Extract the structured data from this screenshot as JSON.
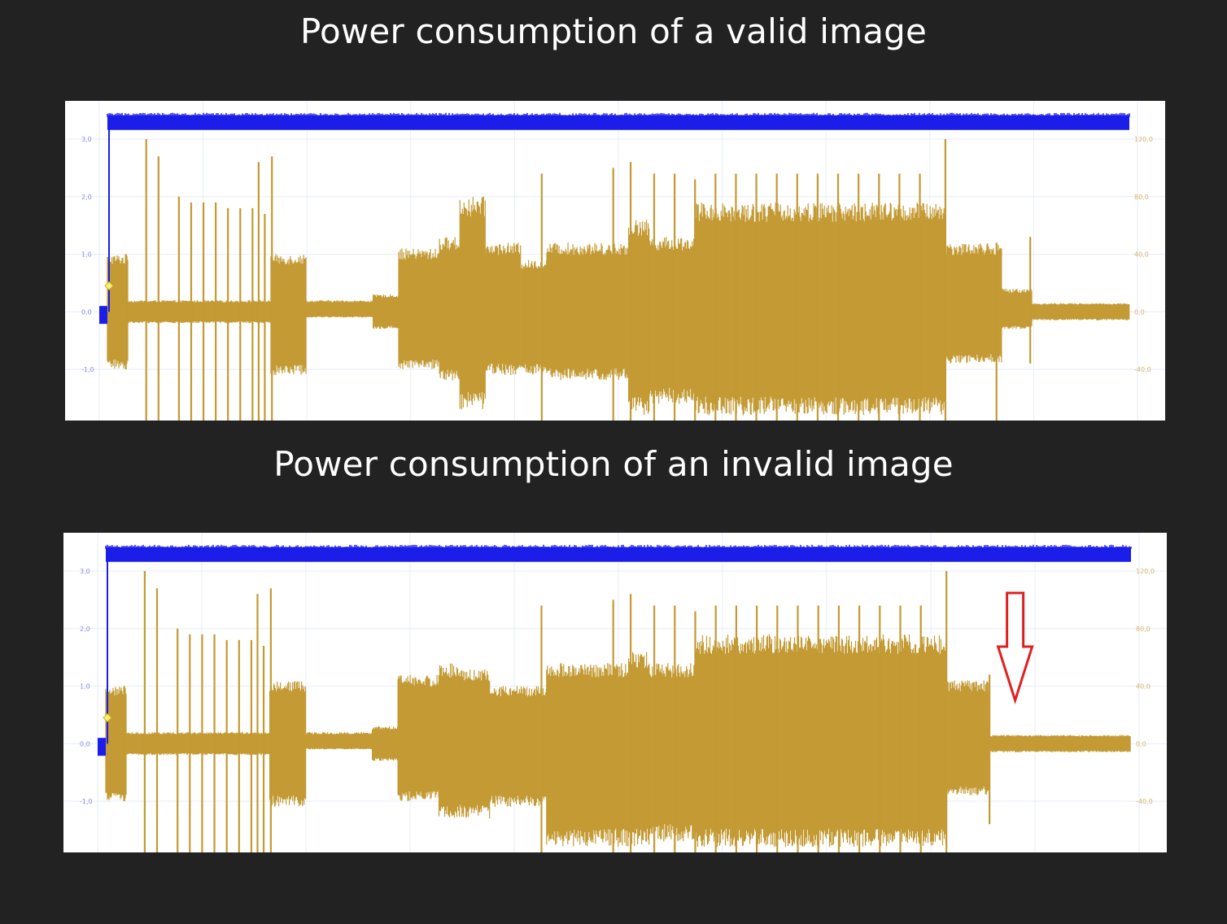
{
  "colors": {
    "background": "#222222",
    "panel": "#ffffff",
    "voltage_trace": "#1a1ee8",
    "current_trace": "#c39a33",
    "arrow": "#e02020",
    "grid": "#e6eef8",
    "title_text": "#ffffff"
  },
  "chart_data": [
    {
      "type": "line",
      "title": "Power consumption of a valid image",
      "xlabel": "",
      "ylabel": "",
      "left_axis": {
        "ticks": [
          "3,0",
          "2,0",
          "1,0",
          "0,0",
          "-1,0"
        ],
        "values": [
          3,
          2,
          1,
          0,
          -1
        ]
      },
      "right_axis": {
        "ticks": [
          "120,0",
          "80,0",
          "40,0",
          "0,0",
          "-40,0"
        ],
        "values": [
          120,
          80,
          40,
          0,
          -40
        ]
      },
      "grid": true,
      "series": [
        {
          "trace": "voltage",
          "level": 3.3,
          "start": 0.0
        },
        {
          "trace": "current",
          "segments": [
            {
              "x0": 0.0,
              "x1": 0.02,
              "hi": 1.0,
              "lo": -1.0
            },
            {
              "x0": 0.02,
              "x1": 0.16,
              "hi": 0.2,
              "lo": -0.2
            },
            {
              "x0": 0.16,
              "x1": 0.195,
              "hi": 1.0,
              "lo": -1.1
            },
            {
              "x0": 0.195,
              "x1": 0.26,
              "hi": 0.2,
              "lo": -0.1
            },
            {
              "x0": 0.26,
              "x1": 0.285,
              "hi": 0.3,
              "lo": -0.3
            },
            {
              "x0": 0.285,
              "x1": 0.325,
              "hi": 1.1,
              "lo": -1.0
            },
            {
              "x0": 0.325,
              "x1": 0.345,
              "hi": 1.3,
              "lo": -1.2
            },
            {
              "x0": 0.345,
              "x1": 0.37,
              "hi": 2.0,
              "lo": -1.7
            },
            {
              "x0": 0.37,
              "x1": 0.405,
              "hi": 1.2,
              "lo": -1.1
            },
            {
              "x0": 0.405,
              "x1": 0.43,
              "hi": 0.9,
              "lo": -1.1
            },
            {
              "x0": 0.43,
              "x1": 0.51,
              "hi": 1.2,
              "lo": -1.2
            },
            {
              "x0": 0.51,
              "x1": 0.53,
              "hi": 1.6,
              "lo": -1.8
            },
            {
              "x0": 0.53,
              "x1": 0.575,
              "hi": 1.3,
              "lo": -1.6
            },
            {
              "x0": 0.575,
              "x1": 0.82,
              "hi": 1.9,
              "lo": -1.8
            },
            {
              "x0": 0.82,
              "x1": 0.875,
              "hi": 1.2,
              "lo": -0.9
            },
            {
              "x0": 0.875,
              "x1": 0.905,
              "hi": 0.4,
              "lo": -0.3
            },
            {
              "x0": 0.905,
              "x1": 1.0,
              "hi": 0.15,
              "lo": -0.15
            }
          ],
          "spikes": [
            {
              "x": 0.018,
              "hi": 1.0,
              "lo": -1.0
            },
            {
              "x": 0.038,
              "hi": 3.0,
              "lo": -1.9
            },
            {
              "x": 0.05,
              "hi": 2.7,
              "lo": -1.9
            },
            {
              "x": 0.07,
              "hi": 2.0,
              "lo": -1.9
            },
            {
              "x": 0.082,
              "hi": 1.9,
              "lo": -1.9
            },
            {
              "x": 0.094,
              "hi": 1.9,
              "lo": -1.9
            },
            {
              "x": 0.106,
              "hi": 1.9,
              "lo": -1.9
            },
            {
              "x": 0.118,
              "hi": 1.8,
              "lo": -1.9
            },
            {
              "x": 0.13,
              "hi": 1.8,
              "lo": -1.9
            },
            {
              "x": 0.142,
              "hi": 1.8,
              "lo": -1.9
            },
            {
              "x": 0.154,
              "hi": 1.7,
              "lo": -1.9
            },
            {
              "x": 0.148,
              "hi": 2.6,
              "lo": -1.9
            },
            {
              "x": 0.161,
              "hi": 2.7,
              "lo": -1.9
            },
            {
              "x": 0.425,
              "hi": 2.4,
              "lo": -1.9
            },
            {
              "x": 0.495,
              "hi": 2.5,
              "lo": -1.9
            },
            {
              "x": 0.512,
              "hi": 2.6,
              "lo": -1.9
            },
            {
              "x": 0.535,
              "hi": 2.4,
              "lo": -1.9
            },
            {
              "x": 0.555,
              "hi": 2.4,
              "lo": -1.9
            },
            {
              "x": 0.575,
              "hi": 2.3,
              "lo": -1.9
            },
            {
              "x": 0.595,
              "hi": 2.4,
              "lo": -1.9
            },
            {
              "x": 0.615,
              "hi": 2.4,
              "lo": -1.9
            },
            {
              "x": 0.635,
              "hi": 2.4,
              "lo": -1.9
            },
            {
              "x": 0.655,
              "hi": 2.4,
              "lo": -1.9
            },
            {
              "x": 0.675,
              "hi": 2.4,
              "lo": -1.9
            },
            {
              "x": 0.695,
              "hi": 2.4,
              "lo": -1.9
            },
            {
              "x": 0.715,
              "hi": 2.4,
              "lo": -1.9
            },
            {
              "x": 0.735,
              "hi": 2.4,
              "lo": -1.9
            },
            {
              "x": 0.755,
              "hi": 2.4,
              "lo": -1.9
            },
            {
              "x": 0.775,
              "hi": 2.4,
              "lo": -1.9
            },
            {
              "x": 0.795,
              "hi": 2.4,
              "lo": -1.9
            },
            {
              "x": 0.82,
              "hi": 3.0,
              "lo": -1.9
            },
            {
              "x": 0.87,
              "hi": 1.2,
              "lo": -1.9
            },
            {
              "x": 0.903,
              "hi": 1.3,
              "lo": -0.9
            }
          ]
        }
      ]
    },
    {
      "type": "line",
      "title": "Power consumption of an invalid image",
      "xlabel": "",
      "ylabel": "",
      "left_axis": {
        "ticks": [
          "3,0",
          "2,0",
          "1,0",
          "0,0",
          "-1,0"
        ],
        "values": [
          3,
          2,
          1,
          0,
          -1
        ]
      },
      "right_axis": {
        "ticks": [
          "120,0",
          "80,0",
          "40,0",
          "0,0",
          "-40,0"
        ],
        "values": [
          120,
          80,
          40,
          0,
          -40
        ]
      },
      "grid": true,
      "series": [
        {
          "trace": "voltage",
          "level": 3.3,
          "start": 0.0
        },
        {
          "trace": "current",
          "segments": [
            {
              "x0": 0.0,
              "x1": 0.02,
              "hi": 1.0,
              "lo": -1.0
            },
            {
              "x0": 0.02,
              "x1": 0.16,
              "hi": 0.2,
              "lo": -0.2
            },
            {
              "x0": 0.16,
              "x1": 0.195,
              "hi": 1.1,
              "lo": -1.1
            },
            {
              "x0": 0.195,
              "x1": 0.26,
              "hi": 0.2,
              "lo": -0.1
            },
            {
              "x0": 0.26,
              "x1": 0.285,
              "hi": 0.3,
              "lo": -0.3
            },
            {
              "x0": 0.285,
              "x1": 0.325,
              "hi": 1.2,
              "lo": -1.0
            },
            {
              "x0": 0.325,
              "x1": 0.345,
              "hi": 1.4,
              "lo": -1.3
            },
            {
              "x0": 0.345,
              "x1": 0.375,
              "hi": 1.3,
              "lo": -1.3
            },
            {
              "x0": 0.375,
              "x1": 0.43,
              "hi": 1.0,
              "lo": -1.1
            },
            {
              "x0": 0.43,
              "x1": 0.51,
              "hi": 1.4,
              "lo": -1.8
            },
            {
              "x0": 0.51,
              "x1": 0.53,
              "hi": 1.6,
              "lo": -1.8
            },
            {
              "x0": 0.53,
              "x1": 0.575,
              "hi": 1.4,
              "lo": -1.7
            },
            {
              "x0": 0.575,
              "x1": 0.82,
              "hi": 1.9,
              "lo": -1.8
            },
            {
              "x0": 0.82,
              "x1": 0.862,
              "hi": 1.1,
              "lo": -0.9
            },
            {
              "x0": 0.862,
              "x1": 1.0,
              "hi": 0.15,
              "lo": -0.15
            }
          ],
          "spikes": [
            {
              "x": 0.018,
              "hi": 1.0,
              "lo": -1.0
            },
            {
              "x": 0.038,
              "hi": 3.0,
              "lo": -1.9
            },
            {
              "x": 0.05,
              "hi": 2.7,
              "lo": -1.9
            },
            {
              "x": 0.07,
              "hi": 2.0,
              "lo": -1.9
            },
            {
              "x": 0.082,
              "hi": 1.9,
              "lo": -1.9
            },
            {
              "x": 0.094,
              "hi": 1.9,
              "lo": -1.9
            },
            {
              "x": 0.106,
              "hi": 1.9,
              "lo": -1.9
            },
            {
              "x": 0.118,
              "hi": 1.8,
              "lo": -1.9
            },
            {
              "x": 0.13,
              "hi": 1.8,
              "lo": -1.9
            },
            {
              "x": 0.142,
              "hi": 1.8,
              "lo": -1.9
            },
            {
              "x": 0.154,
              "hi": 1.7,
              "lo": -1.9
            },
            {
              "x": 0.148,
              "hi": 2.6,
              "lo": -1.9
            },
            {
              "x": 0.161,
              "hi": 2.7,
              "lo": -1.9
            },
            {
              "x": 0.425,
              "hi": 2.4,
              "lo": -1.9
            },
            {
              "x": 0.495,
              "hi": 2.5,
              "lo": -1.9
            },
            {
              "x": 0.512,
              "hi": 2.6,
              "lo": -1.9
            },
            {
              "x": 0.535,
              "hi": 2.4,
              "lo": -1.9
            },
            {
              "x": 0.555,
              "hi": 2.4,
              "lo": -1.9
            },
            {
              "x": 0.575,
              "hi": 2.3,
              "lo": -1.9
            },
            {
              "x": 0.595,
              "hi": 2.4,
              "lo": -1.9
            },
            {
              "x": 0.615,
              "hi": 2.4,
              "lo": -1.9
            },
            {
              "x": 0.635,
              "hi": 2.4,
              "lo": -1.9
            },
            {
              "x": 0.655,
              "hi": 2.4,
              "lo": -1.9
            },
            {
              "x": 0.675,
              "hi": 2.4,
              "lo": -1.9
            },
            {
              "x": 0.695,
              "hi": 2.4,
              "lo": -1.9
            },
            {
              "x": 0.715,
              "hi": 2.4,
              "lo": -1.9
            },
            {
              "x": 0.735,
              "hi": 2.4,
              "lo": -1.9
            },
            {
              "x": 0.755,
              "hi": 2.4,
              "lo": -1.9
            },
            {
              "x": 0.775,
              "hi": 2.4,
              "lo": -1.9
            },
            {
              "x": 0.795,
              "hi": 2.4,
              "lo": -1.9
            },
            {
              "x": 0.82,
              "hi": 3.0,
              "lo": -1.9
            },
            {
              "x": 0.862,
              "hi": 1.2,
              "lo": -1.4
            }
          ]
        }
      ],
      "annotation": {
        "type": "arrow-down",
        "x": 0.887
      }
    }
  ]
}
